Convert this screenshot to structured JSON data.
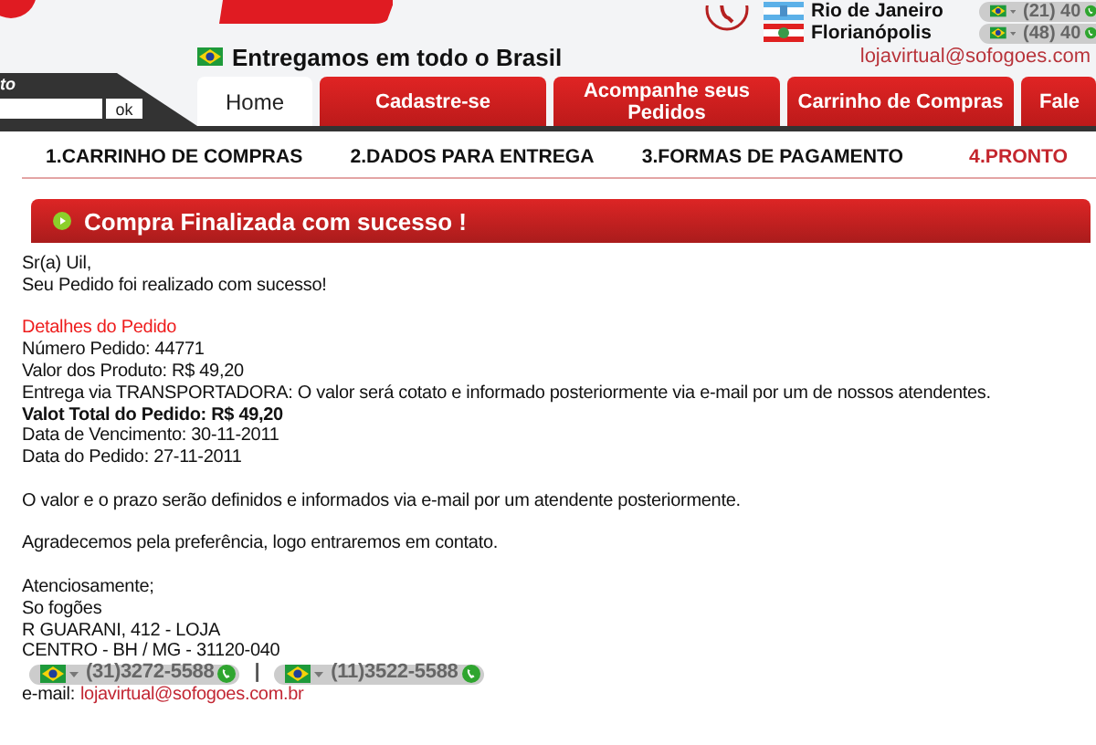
{
  "header": {
    "cities": [
      {
        "name": "Rio de Janeiro",
        "phone": "(21) 40",
        "kind": "rio"
      },
      {
        "name": "Florianópolis",
        "phone": "(48) 40",
        "kind": "sc"
      }
    ],
    "tagline": "Entregamos em todo o Brasil",
    "email": "lojavirtual@sofogoes.com"
  },
  "search": {
    "label": "to",
    "button": "ok"
  },
  "tabs": [
    {
      "label": "Home",
      "selected": true
    },
    {
      "label": "Cadastre-se",
      "selected": false
    },
    {
      "label": "Acompanhe seus Pedidos",
      "selected": false
    },
    {
      "label": "Carrinho de Compras",
      "selected": false
    },
    {
      "label": "Fale",
      "selected": false
    }
  ],
  "steps": [
    {
      "label": "1.CARRINHO DE COMPRAS",
      "selected": false
    },
    {
      "label": "2.DADOS PARA ENTREGA",
      "selected": false
    },
    {
      "label": "3.FORMAS DE PAGAMENTO",
      "selected": false
    },
    {
      "label": "4.PRONTO",
      "selected": true
    }
  ],
  "banner": {
    "title": "Compra Finalizada com sucesso !"
  },
  "message": [
    {
      "lines": [
        {
          "kind": "text",
          "text": "Sr(a) Uil,"
        },
        {
          "kind": "text",
          "text": "Seu Pedido foi realizado com sucesso!"
        }
      ]
    },
    {
      "lines": [
        {
          "kind": "heading",
          "text": "Detalhes do Pedido"
        },
        {
          "kind": "text",
          "text": "Número Pedido: 44771"
        },
        {
          "kind": "text",
          "text": "Valor dos Produto: R$ 49,20"
        },
        {
          "kind": "text",
          "text": "Entrega via TRANSPORTADORA: O valor será cotato e informado posteriormente via e-mail por um de nossos atendentes."
        },
        {
          "kind": "strong",
          "text": "Valot Total do Pedido: R$ 49,20"
        },
        {
          "kind": "text",
          "text": "Data de Vencimento: 30-11-2011"
        },
        {
          "kind": "text",
          "text": "Data do Pedido: 27-11-2011"
        }
      ]
    },
    {
      "lines": [
        {
          "kind": "text",
          "text": "O valor e o prazo serão definidos e informados via e-mail por um atendente posteriormente."
        }
      ]
    },
    {
      "lines": [
        {
          "kind": "text",
          "text": "Agradecemos pela preferência, logo entraremos em contato."
        }
      ]
    },
    {
      "lines": [
        {
          "kind": "text",
          "text": "Atenciosamente;"
        },
        {
          "kind": "text",
          "text": "So fogões"
        },
        {
          "kind": "text",
          "text": "R GUARANI, 412 - LOJA"
        },
        {
          "kind": "text",
          "text": "CENTRO - BH / MG - 31120-040"
        },
        {
          "kind": "phones",
          "phones": [
            "(31)3272-5588",
            "(11)3522-5588"
          ],
          "separator": "|"
        },
        {
          "kind": "email",
          "label": "e-mail:",
          "address": "lojavirtual@sofogoes.com.br"
        }
      ]
    }
  ]
}
